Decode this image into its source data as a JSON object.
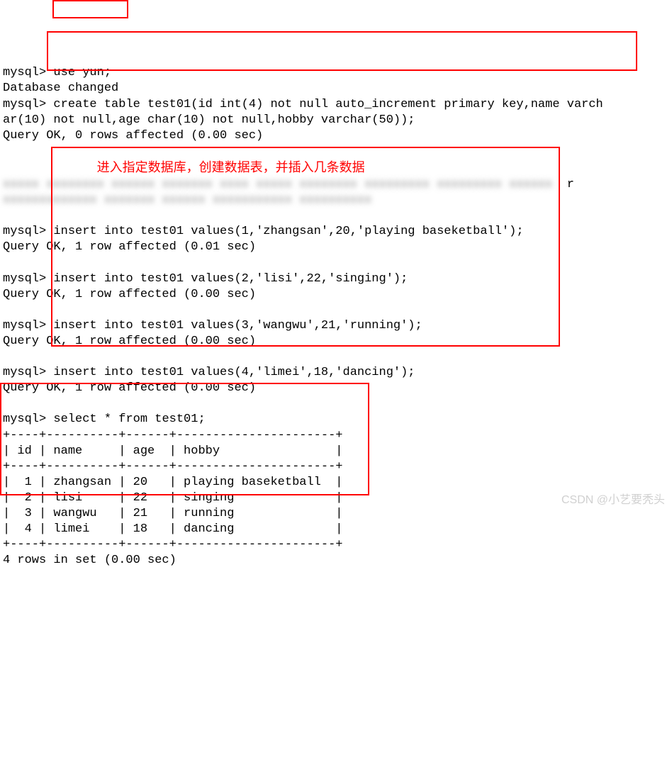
{
  "prompt": "mysql>",
  "lines": {
    "l1_cmd": "use yun;",
    "l2": "Database changed",
    "l3a": "create table test01(id int(4) not null auto_increment primary key,name varch",
    "l3b": "ar(10) not null,age char(10) not null,hobby varchar(50));",
    "l4": "Query OK, 0 rows affected (0.00 sec)",
    "annotation": "进入指定数据库，创建数据表，并插入几条数据",
    "blur_r": "r",
    "ins1": "insert into test01 values(1,'zhangsan',20,'playing baseketball');",
    "ok1": "Query OK, 1 row affected (0.01 sec)",
    "ins2": "insert into test01 values(2,'lisi',22,'singing');",
    "ok2": "Query OK, 1 row affected (0.00 sec)",
    "ins3": "insert into test01 values(3,'wangwu',21,'running');",
    "ok3": "Query OK, 1 row affected (0.00 sec)",
    "ins4": "insert into test01 values(4,'limei',18,'dancing');",
    "ok4": "Query OK, 1 row affected (0.00 sec)",
    "sel": "select * from test01;",
    "tborder": "+----+----------+------+----------------------+",
    "thead": "| id | name     | age  | hobby                |",
    "r1": "|  1 | zhangsan | 20   | playing baseketball  |",
    "r2": "|  2 | lisi     | 22   | singing              |",
    "r3": "|  3 | wangwu   | 21   | running              |",
    "r4": "|  4 | limei    | 18   | dancing              |",
    "rowsset": "4 rows in set (0.00 sec)"
  },
  "chart_data": {
    "type": "table",
    "columns": [
      "id",
      "name",
      "age",
      "hobby"
    ],
    "rows": [
      [
        1,
        "zhangsan",
        20,
        "playing baseketball"
      ],
      [
        2,
        "lisi",
        22,
        "singing"
      ],
      [
        3,
        "wangwu",
        21,
        "running"
      ],
      [
        4,
        "limei",
        18,
        "dancing"
      ]
    ]
  },
  "watermark": "CSDN @小艺要秃头"
}
